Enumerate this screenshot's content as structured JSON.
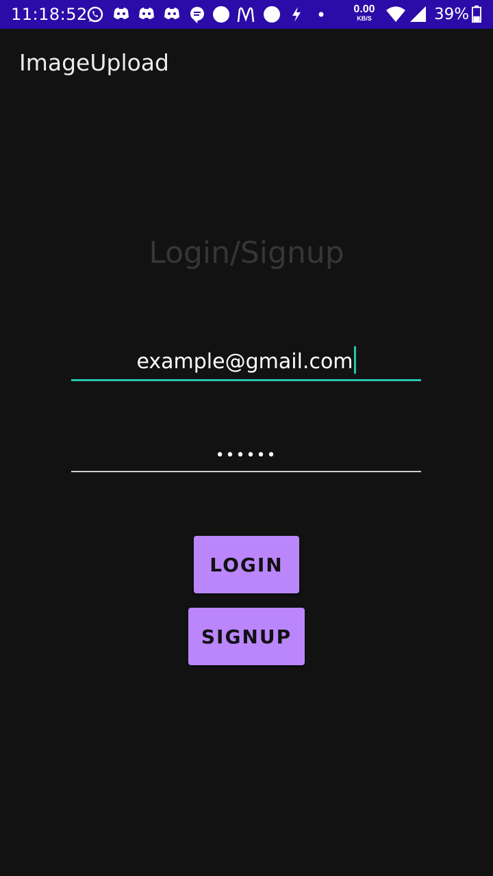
{
  "status_bar": {
    "time": "11:18:52",
    "net_speed_value": "0.00",
    "net_speed_unit": "KB/S",
    "battery_percent": "39%",
    "icons": [
      "whatsapp-icon",
      "discord-icon",
      "discord-icon",
      "discord-icon",
      "chat-icon",
      "circle-icon",
      "mcdonalds-icon",
      "circle-icon",
      "flash-icon",
      "dot-icon",
      "wifi-icon",
      "signal-icon",
      "battery-icon"
    ],
    "background": "#2c0ca8"
  },
  "app_bar": {
    "title": "ImageUpload"
  },
  "main": {
    "heading": "Login/Signup",
    "email_value": "example@gmail.com",
    "password_value": "••••••",
    "login_label": "LOGIN",
    "signup_label": "SIGNUP"
  },
  "colors": {
    "background": "#121212",
    "accent": "#26c6b2",
    "button": "#bb86fc"
  }
}
